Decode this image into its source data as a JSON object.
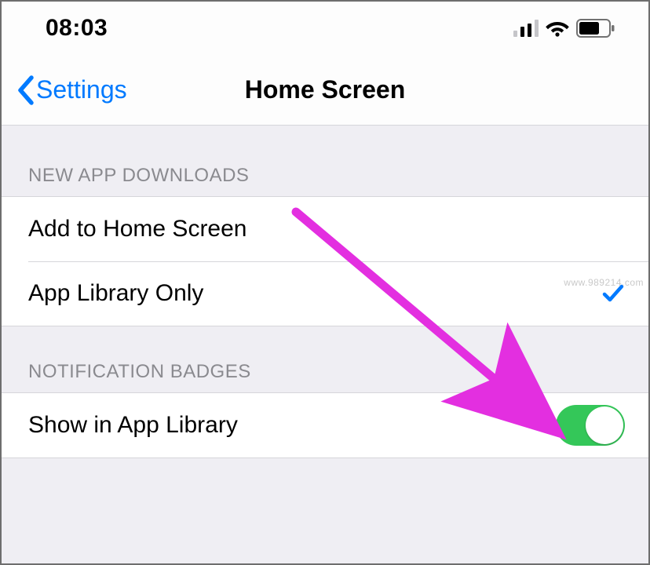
{
  "status": {
    "time": "08:03"
  },
  "nav": {
    "back_label": "Settings",
    "title": "Home Screen"
  },
  "sections": {
    "downloads": {
      "header": "NEW APP DOWNLOADS",
      "options": [
        {
          "label": "Add to Home Screen",
          "selected": false
        },
        {
          "label": "App Library Only",
          "selected": true
        }
      ]
    },
    "badges": {
      "header": "NOTIFICATION BADGES",
      "show_in_app_library": {
        "label": "Show in App Library",
        "value": true
      }
    }
  },
  "colors": {
    "tint": "#007aff",
    "toggle_on": "#34c759",
    "annotation": "#e32fe0"
  },
  "watermark": "www.989214.com"
}
